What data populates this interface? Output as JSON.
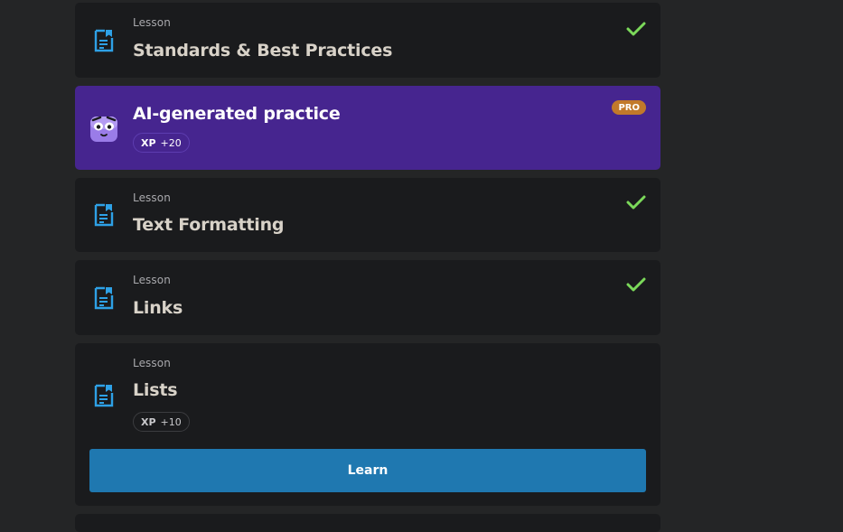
{
  "items": [
    {
      "kind": "Lesson",
      "title": "Standards & Best Practices",
      "completed": true
    },
    {
      "title": "AI-generated practice",
      "badge": "PRO",
      "xp_label": "XP",
      "xp_value": "+20"
    },
    {
      "kind": "Lesson",
      "title": "Text Formatting",
      "completed": true
    },
    {
      "kind": "Lesson",
      "title": "Links",
      "completed": true
    },
    {
      "kind": "Lesson",
      "title": "Lists",
      "xp_label": "XP",
      "xp_value": "+10",
      "button_label": "Learn"
    }
  ],
  "icons": {
    "lesson": "lesson-document-icon",
    "completed": "checkmark-icon",
    "ai_practice": "ai-mascot-icon"
  },
  "colors": {
    "page_bg": "#242526",
    "card_bg": "#1a1b1d",
    "pro_card_bg": "#46258f",
    "accent_blue": "#1f78b0",
    "check_green": "#7bd95a",
    "pro_badge": "#c2792a"
  }
}
